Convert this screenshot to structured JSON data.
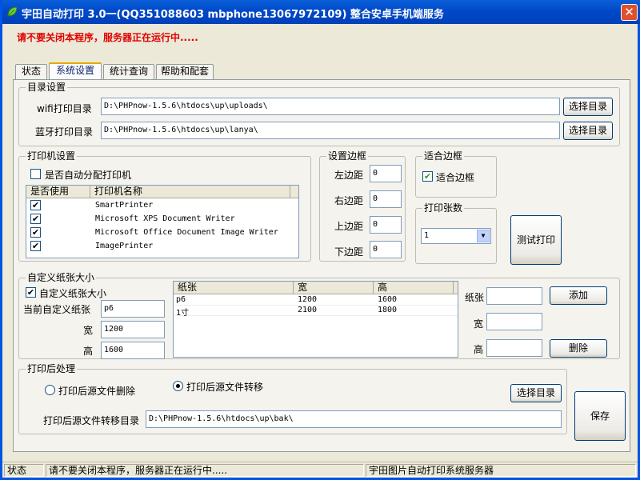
{
  "window": {
    "title": "宇田自动打印 3.0一(QQ351088603 mbphone13067972109) 整合安卓手机端服务",
    "close_symbol": "✕"
  },
  "warning": "请不要关闭本程序，服务器正在运行中.....",
  "tabs": [
    {
      "label": "状态"
    },
    {
      "label": "系统设置"
    },
    {
      "label": "统计查询"
    },
    {
      "label": "帮助和配套"
    }
  ],
  "dir_settings": {
    "title": "目录设置",
    "wifi_label": "wifi打印目录",
    "wifi_path": "D:\\PHPnow-1.5.6\\htdocs\\up\\uploads\\",
    "bt_label": "蓝牙打印目录",
    "bt_path": "D:\\PHPnow-1.5.6\\htdocs\\up\\lanya\\",
    "choose_button": "选择目录"
  },
  "printer_settings": {
    "title": "打印机设置",
    "auto_assign_label": "是否自动分配打印机",
    "col_use": "是否使用",
    "col_name": "打印机名称",
    "printers": [
      {
        "name": "SmartPrinter",
        "checked": "✔"
      },
      {
        "name": "Microsoft XPS Document Writer",
        "checked": "✔"
      },
      {
        "name": "Microsoft Office Document Image Writer",
        "checked": "✔"
      },
      {
        "name": "ImagePrinter",
        "checked": "✔"
      }
    ]
  },
  "margins": {
    "title": "设置边框",
    "left_label": "左边距",
    "left": "0",
    "right_label": "右边距",
    "right": "0",
    "top_label": "上边距",
    "top": "0",
    "bottom_label": "下边距",
    "bottom": "0"
  },
  "fit_border": {
    "title": "适合边框",
    "checkbox_label": "适合边框",
    "checked": "✔"
  },
  "copies": {
    "title": "打印张数",
    "value": "1",
    "arrow": "▼"
  },
  "test_print_button": "测试打印",
  "custom_paper": {
    "title": "自定义纸张大小",
    "enable_label": "自定义纸张大小",
    "enable_checked": "✔",
    "current_label": "当前自定义纸张",
    "current_value": "p6",
    "width_label": "宽",
    "width_value": "1200",
    "height_label": "高",
    "height_value": "1600",
    "table_headers": [
      "纸张",
      "宽",
      "高"
    ],
    "rows": [
      {
        "name": "p6",
        "w": "1200",
        "h": "1600"
      },
      {
        "name": "1寸",
        "w": "2100",
        "h": "1800"
      }
    ],
    "paper_label": "纸张",
    "w_label": "宽",
    "h_label": "高",
    "add_button": "添加",
    "delete_button": "删除"
  },
  "post_process": {
    "title": "打印后处理",
    "delete_label": "打印后源文件删除",
    "move_label": "打印后源文件转移",
    "choose_button": "选择目录",
    "move_dir_label": "打印后源文件转移目录",
    "move_dir": "D:\\PHPnow-1.5.6\\htdocs\\up\\bak\\"
  },
  "save_button": "保存",
  "statusbar": {
    "cell1": "状态",
    "cell2": "请不要关闭本程序，服务器正在运行中.....",
    "cell3": "宇田图片自动打印系统服务器"
  }
}
